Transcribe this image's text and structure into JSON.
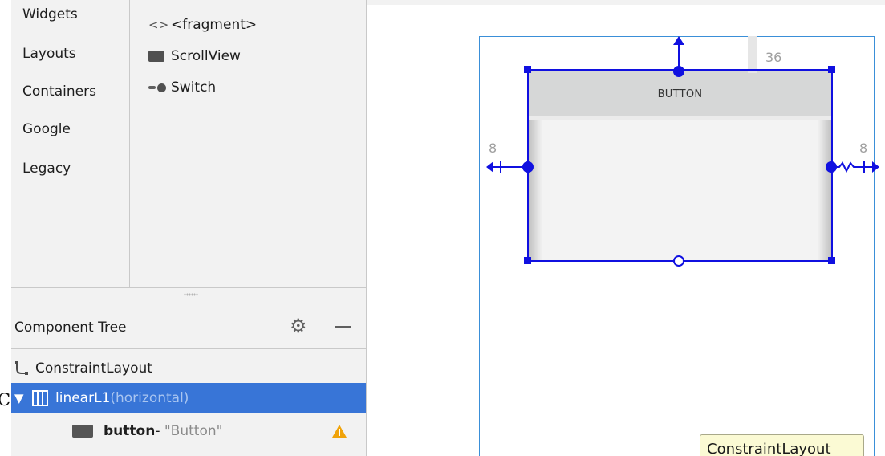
{
  "palette": {
    "categories": [
      "Widgets",
      "Layouts",
      "Containers",
      "Google",
      "Legacy"
    ],
    "widgets": [
      {
        "icon": "fragment-icon",
        "glyph": "<>",
        "label": "<fragment>"
      },
      {
        "icon": "scrollview-icon",
        "label": "ScrollView"
      },
      {
        "icon": "switch-icon",
        "label": "Switch"
      }
    ]
  },
  "component_tree": {
    "title": "Component Tree",
    "rows": [
      {
        "icon": "constraint-layout-icon",
        "label": "ConstraintLayout"
      },
      {
        "icon": "linear-layout-icon",
        "label": "linearL1",
        "suffix": "(horizontal)",
        "selected": true
      },
      {
        "icon": "button-icon",
        "label": "button",
        "separator": "-",
        "text": "\"Button\"",
        "warning": true
      }
    ],
    "left_cut_text": "C"
  },
  "canvas": {
    "button_label": "BUTTON",
    "margins": {
      "top": "36",
      "left": "8",
      "right": "8"
    },
    "tooltip": "ConstraintLayout",
    "constraint_color": "#1010e0",
    "selection_color": "#3875d7",
    "warning_color": "#f0a30a"
  }
}
